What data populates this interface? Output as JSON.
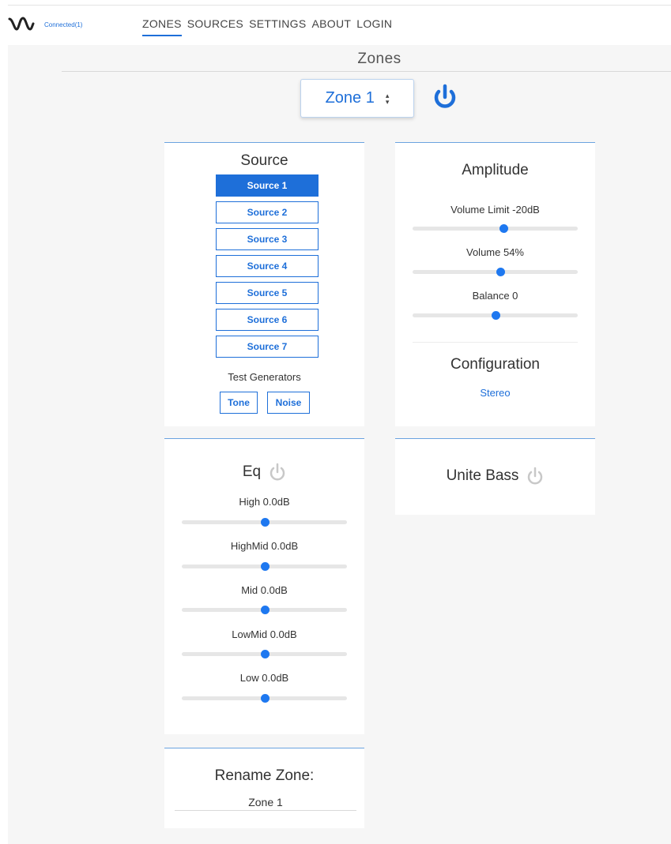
{
  "header": {
    "status": "Connected(1)",
    "nav": [
      "ZONES",
      "SOURCES",
      "SETTINGS",
      "ABOUT",
      "LOGIN"
    ],
    "active_nav": "ZONES"
  },
  "page": {
    "title": "Zones"
  },
  "zone_select": {
    "value": "Zone 1"
  },
  "source_card": {
    "title": "Source",
    "sources": [
      "Source 1",
      "Source 2",
      "Source 3",
      "Source 4",
      "Source 5",
      "Source 6",
      "Source 7"
    ],
    "selected": "Source 1",
    "test_generators_label": "Test Generators",
    "tone": "Tone",
    "noise": "Noise"
  },
  "amplitude_card": {
    "title": "Amplitude",
    "volume_limit": {
      "label": "Volume Limit -20dB",
      "level": 0.55
    },
    "volume": {
      "label": "Volume 54%",
      "level": 0.53
    },
    "balance": {
      "label": "Balance 0",
      "level": 0.5
    },
    "config_title": "Configuration",
    "config_value": "Stereo"
  },
  "eq_card": {
    "title": "Eq",
    "bands": [
      {
        "label": "High 0.0dB",
        "level": 0.5
      },
      {
        "label": "HighMid 0.0dB",
        "level": 0.5
      },
      {
        "label": "Mid  0.0dB",
        "level": 0.5
      },
      {
        "label": "LowMid 0.0dB",
        "level": 0.5
      },
      {
        "label": "Low 0.0dB",
        "level": 0.5
      }
    ]
  },
  "bass_card": {
    "title": "Unite Bass"
  },
  "rename_card": {
    "title": "Rename Zone:",
    "value": "Zone 1"
  },
  "colors": {
    "accent": "#1e6fd9",
    "thumb": "#1e78f0",
    "power_gray": "#c8c8c8"
  }
}
